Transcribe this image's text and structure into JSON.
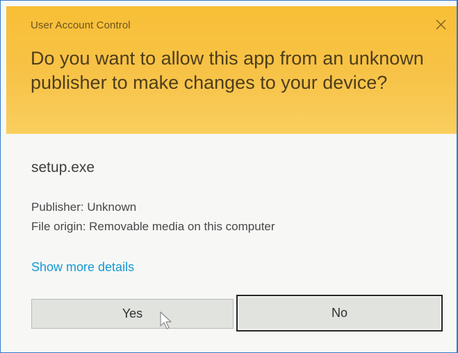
{
  "window": {
    "title": "User Account Control",
    "close_icon": "close-icon"
  },
  "prompt": {
    "question": "Do you want to allow this app from an unknown publisher to make changes to your device?"
  },
  "details": {
    "file_name": "setup.exe",
    "publisher": "Publisher: Unknown",
    "file_origin": "File origin: Removable media on this computer",
    "show_more": "Show more details"
  },
  "buttons": {
    "yes_label": "Yes",
    "no_label": "No"
  },
  "colors": {
    "header_accent": "#f8c13f",
    "link": "#1598d6",
    "window_border": "#2f79c9"
  }
}
